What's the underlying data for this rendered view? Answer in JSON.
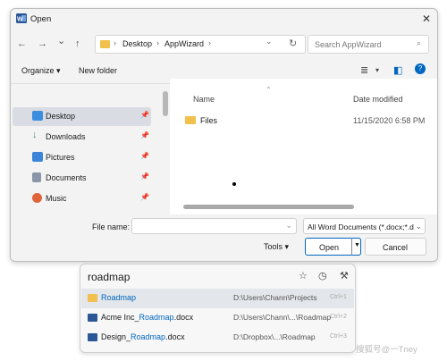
{
  "window": {
    "title": "Open",
    "close_glyph": "✕"
  },
  "nav": {
    "back_glyph": "←",
    "forward_glyph": "→",
    "recent_glyph": "⌄",
    "up_glyph": "↑",
    "crumbs": [
      "Desktop",
      "AppWizard"
    ],
    "sep_glyph": "›",
    "dropdown_glyph": "⌄",
    "refresh_glyph": "↻",
    "search_placeholder": "Search AppWizard",
    "search_glyph": "⌕"
  },
  "commands": {
    "organize": "Organize ▾",
    "new_folder": "New folder",
    "view_glyph": "≣",
    "view_dd": "▾",
    "pane_glyph": "◧",
    "help_glyph": "?"
  },
  "sidebar": {
    "pin_glyph": "📌",
    "items": [
      {
        "label": "Desktop",
        "icon": "desktop-icon",
        "color": "#3c8dde"
      },
      {
        "label": "Downloads",
        "icon": "download-icon",
        "color": "#2f9c5a"
      },
      {
        "label": "Pictures",
        "icon": "pictures-icon",
        "color": "#3b84d8"
      },
      {
        "label": "Documents",
        "icon": "documents-icon",
        "color": "#8a96a8"
      },
      {
        "label": "Music",
        "icon": "music-icon",
        "color": "#e0643c"
      }
    ]
  },
  "content": {
    "col_name": "Name",
    "col_date": "Date modified",
    "sort_glyph": "⌃",
    "rows": [
      {
        "name": "Files",
        "date": "11/15/2020 6:58 PM"
      }
    ]
  },
  "bottom": {
    "file_name_label": "File name:",
    "file_name_value": "",
    "fn_dd": "⌄",
    "file_type": "All Word Documents (*.docx;*.d",
    "type_dd": "⌄",
    "tools": "Tools  ▾",
    "open": "Open",
    "open_split": "▼",
    "cancel": "Cancel"
  },
  "popup": {
    "query": "roadmap",
    "star_glyph": "☆",
    "history_glyph": "◷",
    "tools_glyph": "⚒",
    "results": [
      {
        "pre": "",
        "hl": "Roadmap",
        "post": "",
        "path": "D:\\Users\\Chann\\Projects",
        "key": "Ctrl+1",
        "icon": "folder-icon",
        "color": "#f2c04c"
      },
      {
        "pre": "Acme Inc_",
        "hl": "Roadmap",
        "post": ".docx",
        "path": "D:\\Users\\Chann\\...\\Roadmap",
        "key": "Ctrl+2",
        "icon": "word-doc-icon",
        "color": "#2b5797"
      },
      {
        "pre": "Design_",
        "hl": "Roadmap",
        "post": ".docx",
        "path": "D:\\Dropbox\\...\\Roadmap",
        "key": "Ctrl+3",
        "icon": "word-doc-icon",
        "color": "#2b5797"
      }
    ]
  },
  "watermark": "搜狐号@一Tney"
}
